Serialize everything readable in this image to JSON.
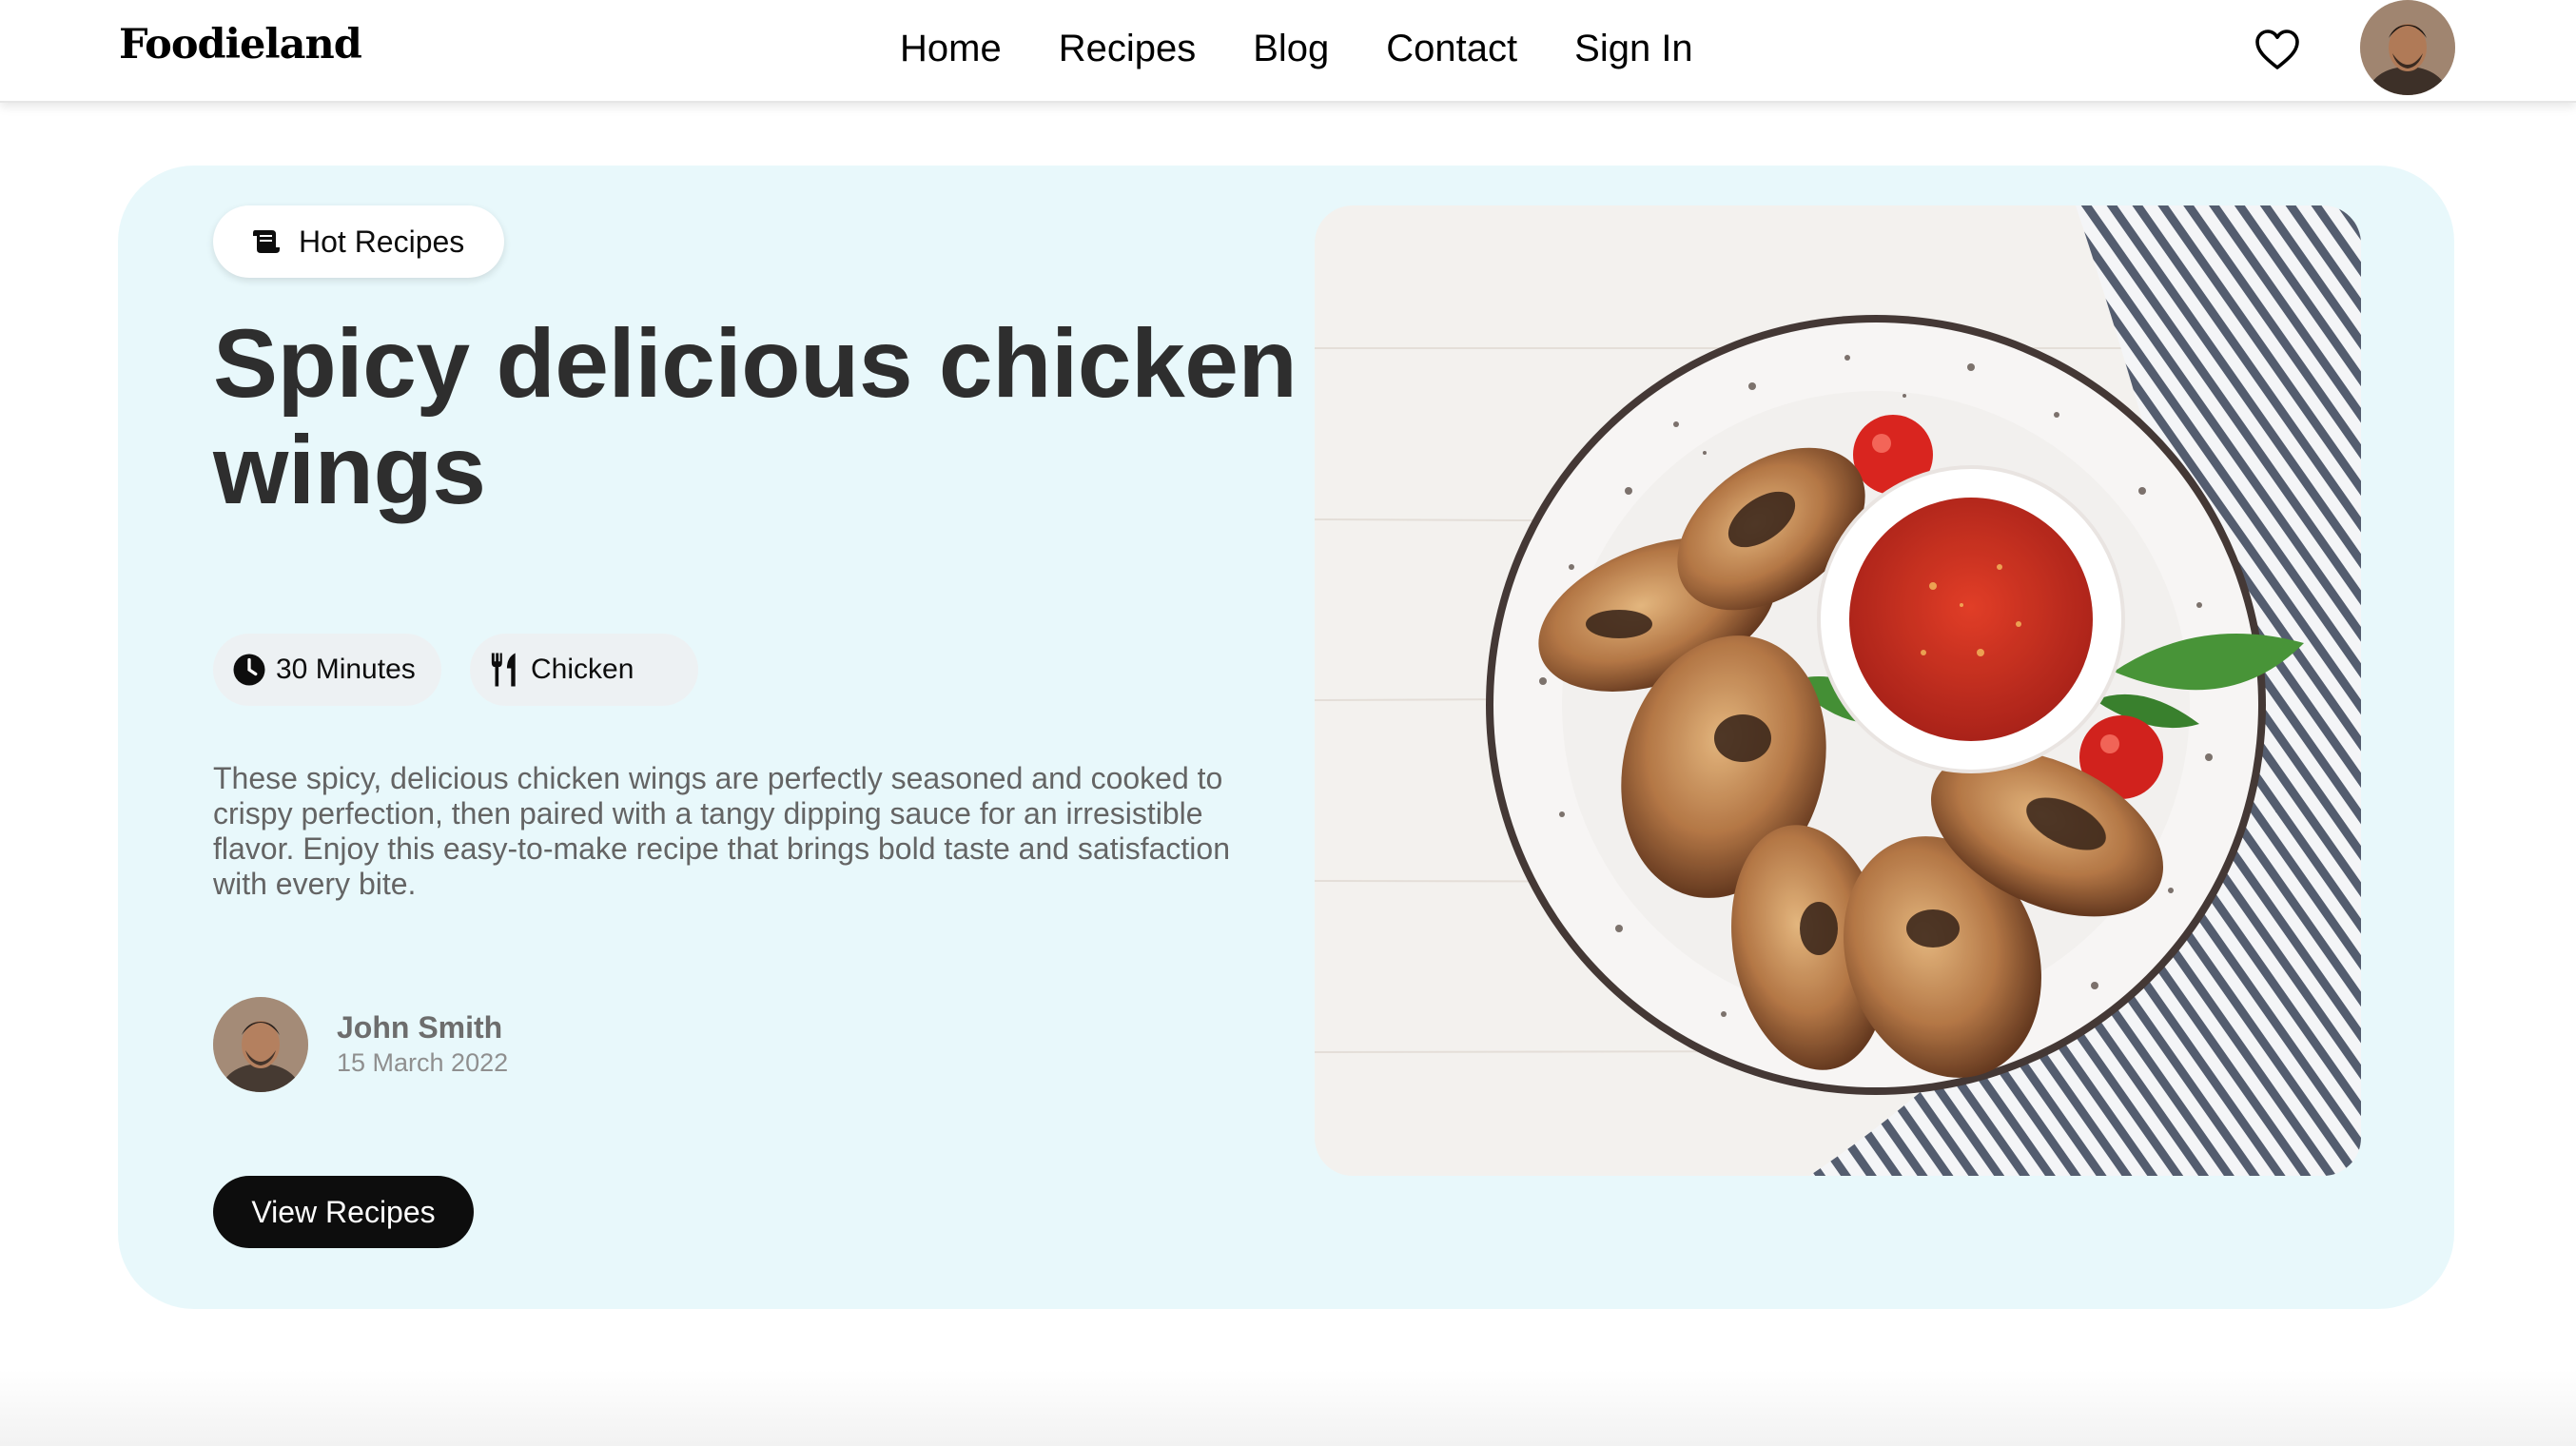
{
  "nav": {
    "logo": "Foodieland",
    "links": [
      "Home",
      "Recipes",
      "Blog",
      "Contact",
      "Sign In"
    ],
    "icons": {
      "favorites": "heart-icon",
      "profile": "avatar"
    }
  },
  "hero": {
    "badge": {
      "label": "Hot Recipes",
      "icon": "paper-scroll-icon"
    },
    "title": "Spicy delicious chicken wings",
    "time": {
      "label": "30 Minutes",
      "icon": "clock-icon"
    },
    "category": {
      "label": "Chicken",
      "icon": "fork-knife-icon"
    },
    "description": "These spicy, delicious chicken wings are perfectly seasoned and cooked to crispy perfection, then paired with a tangy dipping sauce for an irresistible flavor. Enjoy this easy-to-make recipe that brings bold taste and satisfaction with every bite.",
    "author": {
      "name": "John Smith",
      "date": "15 March 2022"
    },
    "cta_label": "View Recipes",
    "image": "chicken-wings-plate-photo"
  },
  "colors": {
    "hero_bg": "#e7f8fb",
    "text_dark": "#232323",
    "cta_bg": "#000000",
    "chip_bg": "#edf1f3"
  }
}
